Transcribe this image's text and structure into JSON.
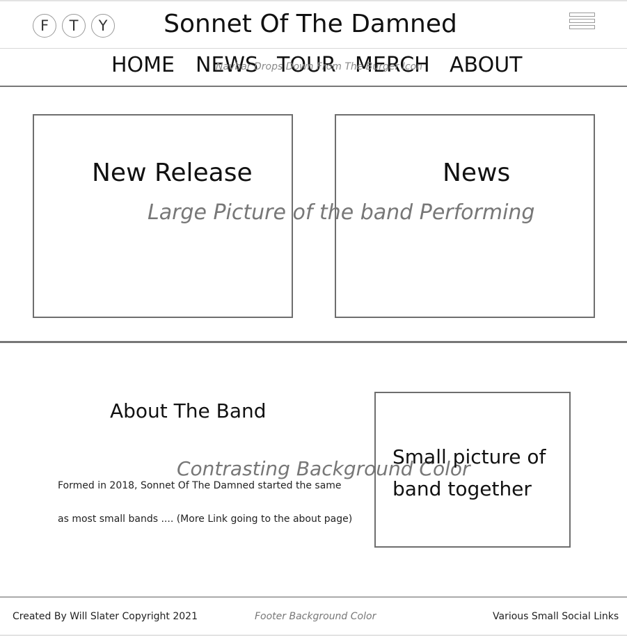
{
  "header": {
    "social_icons": [
      "F",
      "T",
      "Y"
    ],
    "title": "Sonnet Of The Damned",
    "menu_icon": "hamburger-icon"
  },
  "nav": {
    "items": [
      "HOME",
      "NEWS",
      "TOUR",
      "MERCH",
      "ABOUT"
    ],
    "note": "Navbar Drops Down From The Burger Icon"
  },
  "hero": {
    "new_release": "New Release",
    "news": "News",
    "background_note": "Large Picture of the band Performing"
  },
  "about": {
    "heading": "About The Band",
    "background_note": "Contrasting Background Color",
    "text_line1": "Formed in 2018, Sonnet Of The Damned started the same",
    "text_line2": "as most small bands .... (More Link going to the about page)",
    "picture_line1": "Small picture of",
    "picture_line2": "band together"
  },
  "footer": {
    "credit": "Created By Will Slater Copyright 2021",
    "background_note": "Footer Background Color",
    "social_links": "Various Small Social Links"
  }
}
